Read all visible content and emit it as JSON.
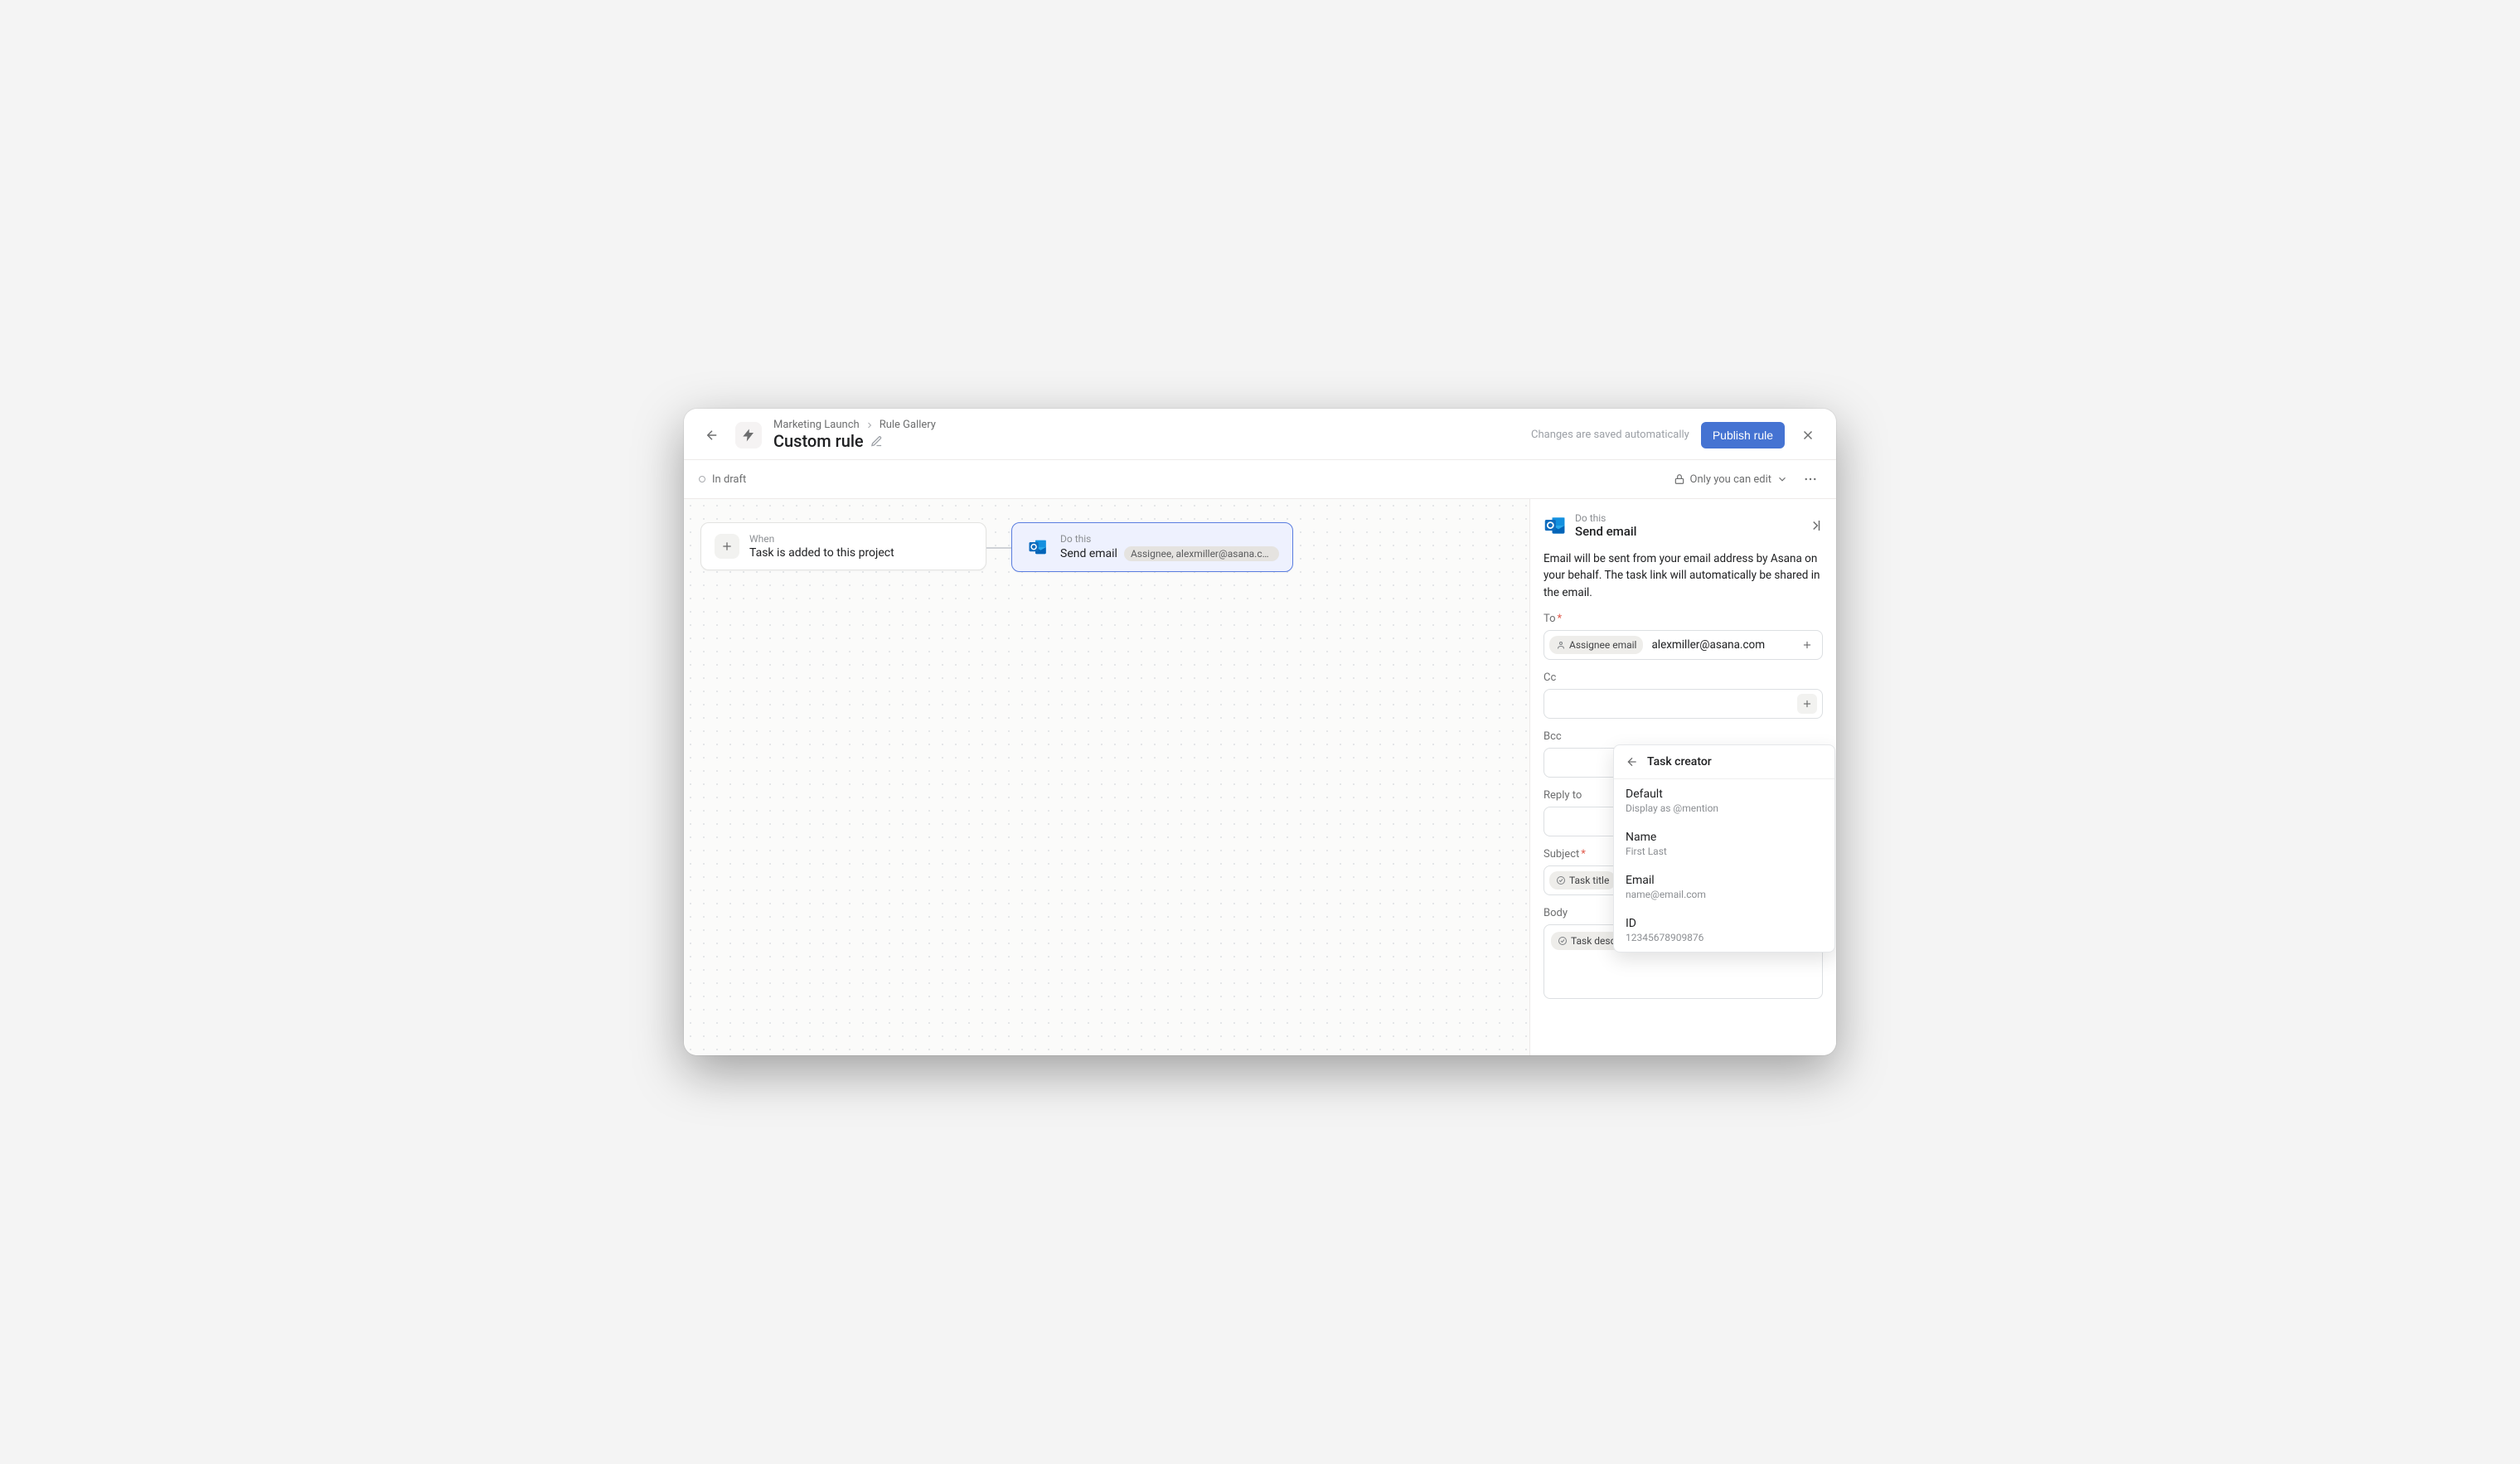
{
  "header": {
    "breadcrumbs": [
      "Marketing Launch",
      "Rule Gallery"
    ],
    "title": "Custom rule",
    "save_hint": "Changes are saved automatically",
    "publish_label": "Publish rule"
  },
  "subheader": {
    "status": "In draft",
    "access": "Only you can edit"
  },
  "canvas": {
    "trigger": {
      "label": "When",
      "title": "Task is added to this project"
    },
    "action": {
      "label": "Do this",
      "title": "Send email",
      "chip": "Assignee, alexmiller@asana.com"
    }
  },
  "panel": {
    "label": "Do this",
    "title": "Send email",
    "description": "Email will be sent from your email address by Asana on your behalf. The task link will automatically be shared in the email.",
    "fields": {
      "to": {
        "label": "To",
        "required": true,
        "tokens": [
          "Assignee email"
        ],
        "values": [
          "alexmiller@asana.com"
        ]
      },
      "cc": {
        "label": "Cc"
      },
      "bcc": {
        "label": "Bcc"
      },
      "reply_to": {
        "label": "Reply to"
      },
      "subject": {
        "label": "Subject",
        "required": true,
        "tokens": [
          "Task title"
        ]
      },
      "body": {
        "label": "Body",
        "tokens": [
          "Task description"
        ]
      }
    }
  },
  "dropdown": {
    "header": "Task creator",
    "items": [
      {
        "title": "Default",
        "sub": "Display as @mention"
      },
      {
        "title": "Name",
        "sub": "First Last"
      },
      {
        "title": "Email",
        "sub": "name@email.com"
      },
      {
        "title": "ID",
        "sub": "12345678909876"
      }
    ]
  }
}
